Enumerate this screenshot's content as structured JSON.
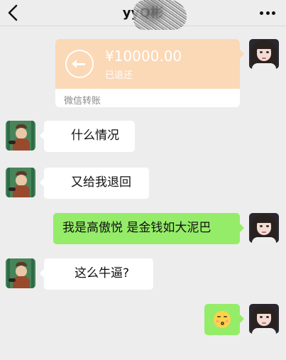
{
  "header": {
    "title": "yyQ彬"
  },
  "transfer": {
    "amount": "¥10000.00",
    "status": "已退还",
    "label": "微信转账"
  },
  "messages": [
    {
      "side": "left",
      "text": "什么情况"
    },
    {
      "side": "left",
      "text": "又给我退回"
    },
    {
      "side": "right",
      "text": "我是高傲悦 是金钱如大泥巴"
    },
    {
      "side": "left",
      "text": "这么牛逼?"
    },
    {
      "side": "right",
      "sticker": "smiling-emoji"
    }
  ],
  "colors": {
    "background": "#ededed",
    "sent_bubble": "#95ec69",
    "received_bubble": "#ffffff",
    "transfer_card": "#fbd8b6"
  },
  "icons": [
    "back-icon",
    "more-icon",
    "transfer-return-icon",
    "smiling-emoji-icon"
  ]
}
